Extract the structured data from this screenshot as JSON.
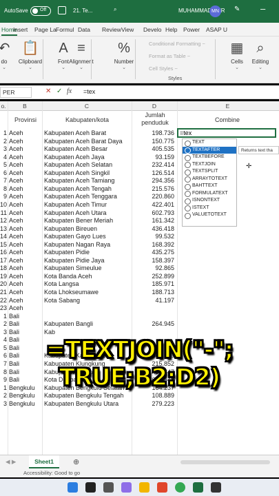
{
  "titlebar": {
    "autosave": "AutoSave",
    "toggle": "Off",
    "file": "21. Te...",
    "user": "MUHAMMAD NUR",
    "avatar": "MN"
  },
  "ribbon_tabs": [
    "Home",
    "Insert",
    "Page La",
    "Formul",
    "Data",
    "Review",
    "View",
    "Develo",
    "Help",
    "Power",
    "ASAP U"
  ],
  "ribbon": {
    "groups": [
      {
        "icon": "undo-icon",
        "label": "do",
        "glyph": "↶"
      },
      {
        "icon": "clipboard-icon",
        "label": "Clipboard",
        "glyph": "📋"
      },
      {
        "icon": "font-icon",
        "label": "Font",
        "glyph": "A"
      },
      {
        "icon": "alignment-icon",
        "label": "Alignment",
        "glyph": "≡"
      },
      {
        "icon": "number-icon",
        "label": "Number",
        "glyph": "%"
      },
      {
        "icon": "cells-icon",
        "label": "Cells",
        "glyph": "▦"
      },
      {
        "icon": "editing-icon",
        "label": "Editing",
        "glyph": "⌕"
      }
    ],
    "styles": [
      "Conditional Formatting ~",
      "Format as Table ~",
      "Cell Styles ~"
    ],
    "styles_label": "Styles"
  },
  "formula_bar": {
    "namebox": "PER",
    "x": "✕",
    "check": "✓",
    "fx": "fx",
    "text": "=tex"
  },
  "columns": [
    "o.",
    "B",
    "C",
    "D",
    "E"
  ],
  "headers": {
    "provinsi": "Provinsi",
    "kab": "Kabupaten/kota",
    "jumlah": "Jumlah penduduk",
    "combine": "Combine"
  },
  "rows": [
    [
      "1",
      "Aceh",
      "Kabupaten Aceh Barat",
      "198.736"
    ],
    [
      "2",
      "Aceh",
      "Kabupaten Aceh Barat Daya",
      "150.775"
    ],
    [
      "3",
      "Aceh",
      "Kabupaten Aceh Besar",
      "405.535"
    ],
    [
      "4",
      "Aceh",
      "Kabupaten Aceh Jaya",
      "93.159"
    ],
    [
      "5",
      "Aceh",
      "Kabupaten Aceh Selatan",
      "232.414"
    ],
    [
      "6",
      "Aceh",
      "Kabupaten Aceh Singkil",
      "126.514"
    ],
    [
      "7",
      "Aceh",
      "Kabupaten Aceh Tamiang",
      "294.356"
    ],
    [
      "8",
      "Aceh",
      "Kabupaten Aceh Tengah",
      "215.576"
    ],
    [
      "9",
      "Aceh",
      "Kabupaten Aceh Tenggara",
      "220.860"
    ],
    [
      "10",
      "Aceh",
      "Kabupaten Aceh Timur",
      "422.401"
    ],
    [
      "11",
      "Aceh",
      "Kabupaten Aceh Utara",
      "602.793"
    ],
    [
      "12",
      "Aceh",
      "Kabupaten Bener Meriah",
      "161.342"
    ],
    [
      "13",
      "Aceh",
      "Kabupaten Bireuen",
      "436.418"
    ],
    [
      "14",
      "Aceh",
      "Kabupaten Gayo Lues",
      "99.532"
    ],
    [
      "15",
      "Aceh",
      "Kabupaten Nagan Raya",
      "168.392"
    ],
    [
      "16",
      "Aceh",
      "Kabupaten Pidie",
      "435.275"
    ],
    [
      "17",
      "Aceh",
      "Kabupaten Pidie Jaya",
      "158.397"
    ],
    [
      "18",
      "Aceh",
      "Kabupaten Simeulue",
      "92.865"
    ],
    [
      "19",
      "Aceh",
      "Kota Banda Aceh",
      "252.899"
    ],
    [
      "20",
      "Aceh",
      "Kota Langsa",
      "185.971"
    ],
    [
      "21",
      "Aceh",
      "Kota Lhokseumawe",
      "188.713"
    ],
    [
      "22",
      "Aceh",
      "Kota Sabang",
      "41.197"
    ],
    [
      "23",
      "Aceh",
      "",
      ""
    ],
    [
      "1",
      "Bali",
      "",
      ""
    ],
    [
      "2",
      "Bali",
      "Kabupaten Bangli",
      "264.945"
    ],
    [
      "3",
      "Bali",
      "Kab",
      ""
    ],
    [
      "4",
      "Bali",
      "",
      ""
    ],
    [
      "5",
      "Bali",
      "",
      ""
    ],
    [
      "6",
      "Bali",
      "Kabupaten Karangasem",
      "545.389"
    ],
    [
      "7",
      "Bali",
      "Kabupaten Klungkung",
      "215.852"
    ],
    [
      "8",
      "Bali",
      "Kabupaten Tabanan",
      "466.647"
    ],
    [
      "9",
      "Bali",
      "Kota Denpasar",
      "638.548"
    ],
    [
      "1",
      "Bengkulu",
      "Kabupaten Bengkulu Selatan",
      "164.237"
    ],
    [
      "2",
      "Bengkulu",
      "Kabupaten Bengkulu Tengah",
      "108.889"
    ],
    [
      "3",
      "Bengkulu",
      "Kabupaten Bengkulu Utara",
      "279.223"
    ]
  ],
  "active_cell": "=tex",
  "autocomplete": [
    "TEXT",
    "TEXTAFTER",
    "TEXTBEFORE",
    "TEXTJOIN",
    "TEXTSPLIT",
    "ARRAYTOTEXT",
    "BAHTTEXT",
    "FORMULATEXT",
    "ISNONTEXT",
    "ISTEXT",
    "VALUETOTEXT"
  ],
  "autocomplete_selected": 1,
  "tooltip": "Returns text tha",
  "overlay": {
    "line1": "=TEXTJOIN(\"-\";",
    "line2": "TRUE;B2:D2)"
  },
  "sheet_tab": "Sheet1",
  "add_sheet": "⊕",
  "status": "Accessibility: Good to go",
  "colors": {
    "excel_green": "#1e6e40",
    "overlay_yellow": "#fff000",
    "selection_blue": "#1f72c4"
  }
}
